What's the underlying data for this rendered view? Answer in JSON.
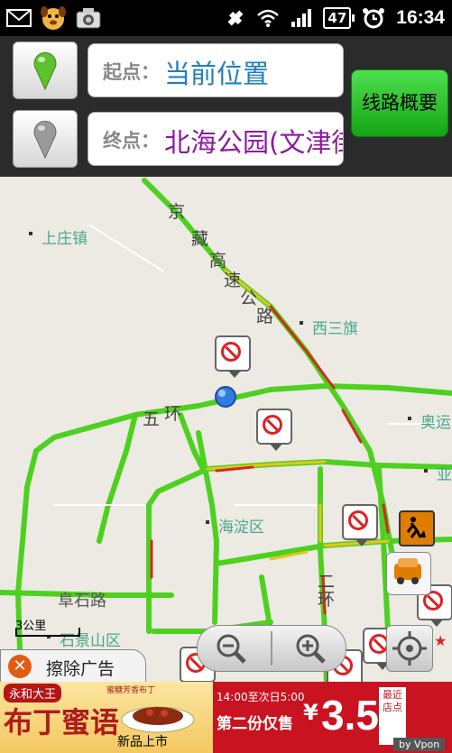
{
  "status_bar": {
    "battery": "47",
    "time": "16:34"
  },
  "route": {
    "start_label": "起点：",
    "start_value": "当前位置",
    "end_label": "终点：",
    "end_value": "北海公园(文津街",
    "overview_button": "线路概要",
    "start_color": "#1f7fc0",
    "end_color": "#8a1a9e"
  },
  "map": {
    "places": {
      "shangzhuang": "上庄镇",
      "xisanqi": "西三旗",
      "ao": "奥运",
      "ya": "亚",
      "haidian": "海淀区",
      "fushilu": "阜石路",
      "shijingshan": "石景山区"
    },
    "road_labels": {
      "jing": "京",
      "zang": "藏",
      "gao": "高",
      "su": "速",
      "gong": "公",
      "lu": "路",
      "wu": "五",
      "huan": "环",
      "er": "二",
      "er_huan": "环"
    },
    "scale_label": "3公里",
    "traffic_colors": {
      "smooth": "#4ed020",
      "slow": "#e8c41a",
      "congested": "#d42a1e"
    }
  },
  "ad_banner": {
    "close_label": "擦除广告",
    "brand": "永和大王",
    "headline": "布丁蜜语",
    "new_text": "新品上市",
    "small_text": "蜜糖芳香布丁",
    "time_text": "14:00至次日5:00",
    "deal_text": "第二份仅售",
    "currency": "¥",
    "price": "3.5",
    "near_text": "最近店点",
    "vpon": "by Vpon"
  }
}
